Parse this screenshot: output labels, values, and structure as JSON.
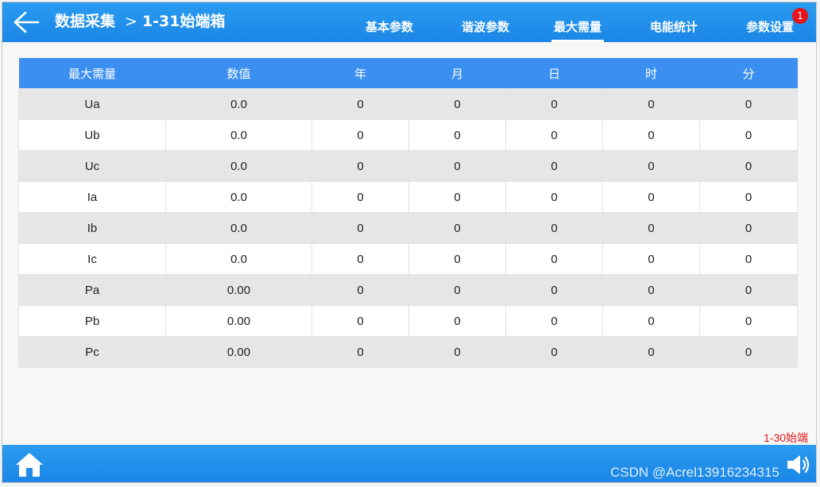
{
  "header": {
    "breadcrumb_root": "数据采集",
    "breadcrumb_separator": ">",
    "breadcrumb_current": "1-31始端箱",
    "tabs": [
      {
        "label": "基本参数",
        "active": false
      },
      {
        "label": "谐波参数",
        "active": false
      },
      {
        "label": "最大需量",
        "active": true
      },
      {
        "label": "电能统计",
        "active": false
      },
      {
        "label": "参数设置",
        "active": false
      }
    ],
    "notification_count": "1"
  },
  "table": {
    "headers": [
      "最大需量",
      "数值",
      "年",
      "月",
      "日",
      "时",
      "分"
    ],
    "rows": [
      [
        "Ua",
        "0.0",
        "0",
        "0",
        "0",
        "0",
        "0"
      ],
      [
        "Ub",
        "0.0",
        "0",
        "0",
        "0",
        "0",
        "0"
      ],
      [
        "Uc",
        "0.0",
        "0",
        "0",
        "0",
        "0",
        "0"
      ],
      [
        "Ia",
        "0.0",
        "0",
        "0",
        "0",
        "0",
        "0"
      ],
      [
        "Ib",
        "0.0",
        "0",
        "0",
        "0",
        "0",
        "0"
      ],
      [
        "Ic",
        "0.0",
        "0",
        "0",
        "0",
        "0",
        "0"
      ],
      [
        "Pa",
        "0.00",
        "0",
        "0",
        "0",
        "0",
        "0"
      ],
      [
        "Pb",
        "0.00",
        "0",
        "0",
        "0",
        "0",
        "0"
      ],
      [
        "Pc",
        "0.00",
        "0",
        "0",
        "0",
        "0",
        "0"
      ]
    ]
  },
  "side_label": "1-30始端",
  "watermark": "CSDN @Acrel13916234315",
  "icons": {
    "back": "arrow-left-icon",
    "home": "home-icon",
    "speaker": "speaker-icon"
  },
  "colors": {
    "bar": "#1b86e6",
    "table_header": "#3a8ff1",
    "badge": "#e8141b",
    "side_label": "#e01919"
  }
}
